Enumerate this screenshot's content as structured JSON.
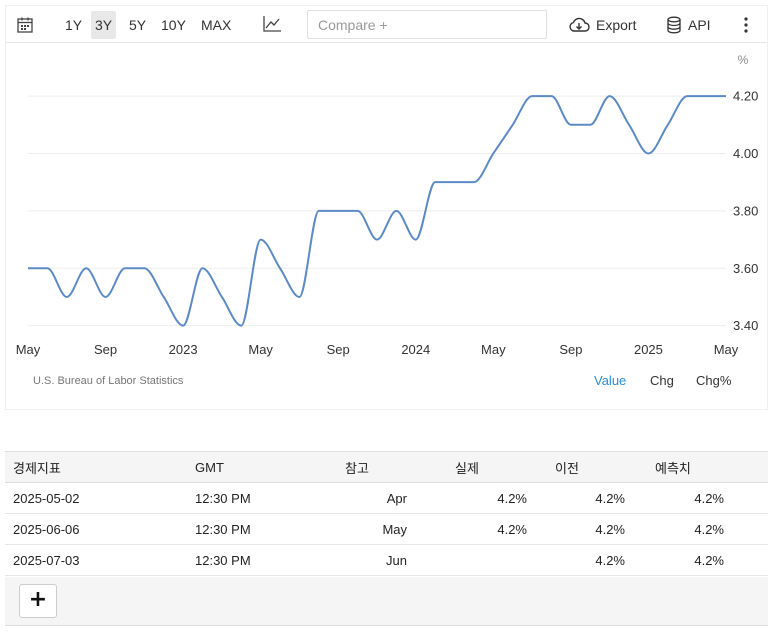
{
  "toolbar": {
    "ranges": [
      "1Y",
      "3Y",
      "5Y",
      "10Y",
      "MAX"
    ],
    "active_range": "3Y",
    "compare_placeholder": "Compare +",
    "export_label": "Export",
    "api_label": "API"
  },
  "chart_data": {
    "type": "line",
    "ylabel": "%",
    "ylim": [
      3.35,
      4.27
    ],
    "yticks": [
      3.4,
      3.6,
      3.8,
      4.0,
      4.2
    ],
    "xticks": [
      "May",
      "Sep",
      "2023",
      "May",
      "Sep",
      "2024",
      "May",
      "Sep",
      "2025",
      "May"
    ],
    "grid": true,
    "line_color": "#5b8ac7",
    "series": [
      {
        "x": [
          "2022-05",
          "2022-06",
          "2022-07",
          "2022-08",
          "2022-09",
          "2022-10",
          "2022-11",
          "2022-12",
          "2023-01",
          "2023-02",
          "2023-03",
          "2023-04",
          "2023-05",
          "2023-06",
          "2023-07",
          "2023-08",
          "2023-09",
          "2023-10",
          "2023-11",
          "2023-12",
          "2024-01",
          "2024-02",
          "2024-03",
          "2024-04",
          "2024-05",
          "2024-06",
          "2024-07",
          "2024-08",
          "2024-09",
          "2024-10",
          "2024-11",
          "2024-12",
          "2025-01",
          "2025-02",
          "2025-03",
          "2025-04",
          "2025-05"
        ],
        "values": [
          3.6,
          3.6,
          3.5,
          3.6,
          3.5,
          3.6,
          3.6,
          3.5,
          3.4,
          3.6,
          3.5,
          3.4,
          3.7,
          3.6,
          3.5,
          3.8,
          3.8,
          3.8,
          3.7,
          3.8,
          3.7,
          3.9,
          3.9,
          3.9,
          4.0,
          4.1,
          4.2,
          4.2,
          4.1,
          4.1,
          4.2,
          4.1,
          4.0,
          4.1,
          4.2,
          4.2,
          4.2
        ]
      }
    ],
    "source": "U.S. Bureau of Labor Statistics"
  },
  "view_options": [
    "Value",
    "Chg",
    "Chg%"
  ],
  "active_view": "Value",
  "calendar": {
    "headers": [
      "경제지표",
      "GMT",
      "참고",
      "실제",
      "이전",
      "예측치"
    ],
    "rows": [
      [
        "2025-05-02",
        "12:30 PM",
        "Apr",
        "4.2%",
        "4.2%",
        "4.2%"
      ],
      [
        "2025-06-06",
        "12:30 PM",
        "May",
        "4.2%",
        "4.2%",
        "4.2%"
      ],
      [
        "2025-07-03",
        "12:30 PM",
        "Jun",
        "",
        "4.2%",
        "4.2%"
      ]
    ],
    "add_label": "+"
  }
}
